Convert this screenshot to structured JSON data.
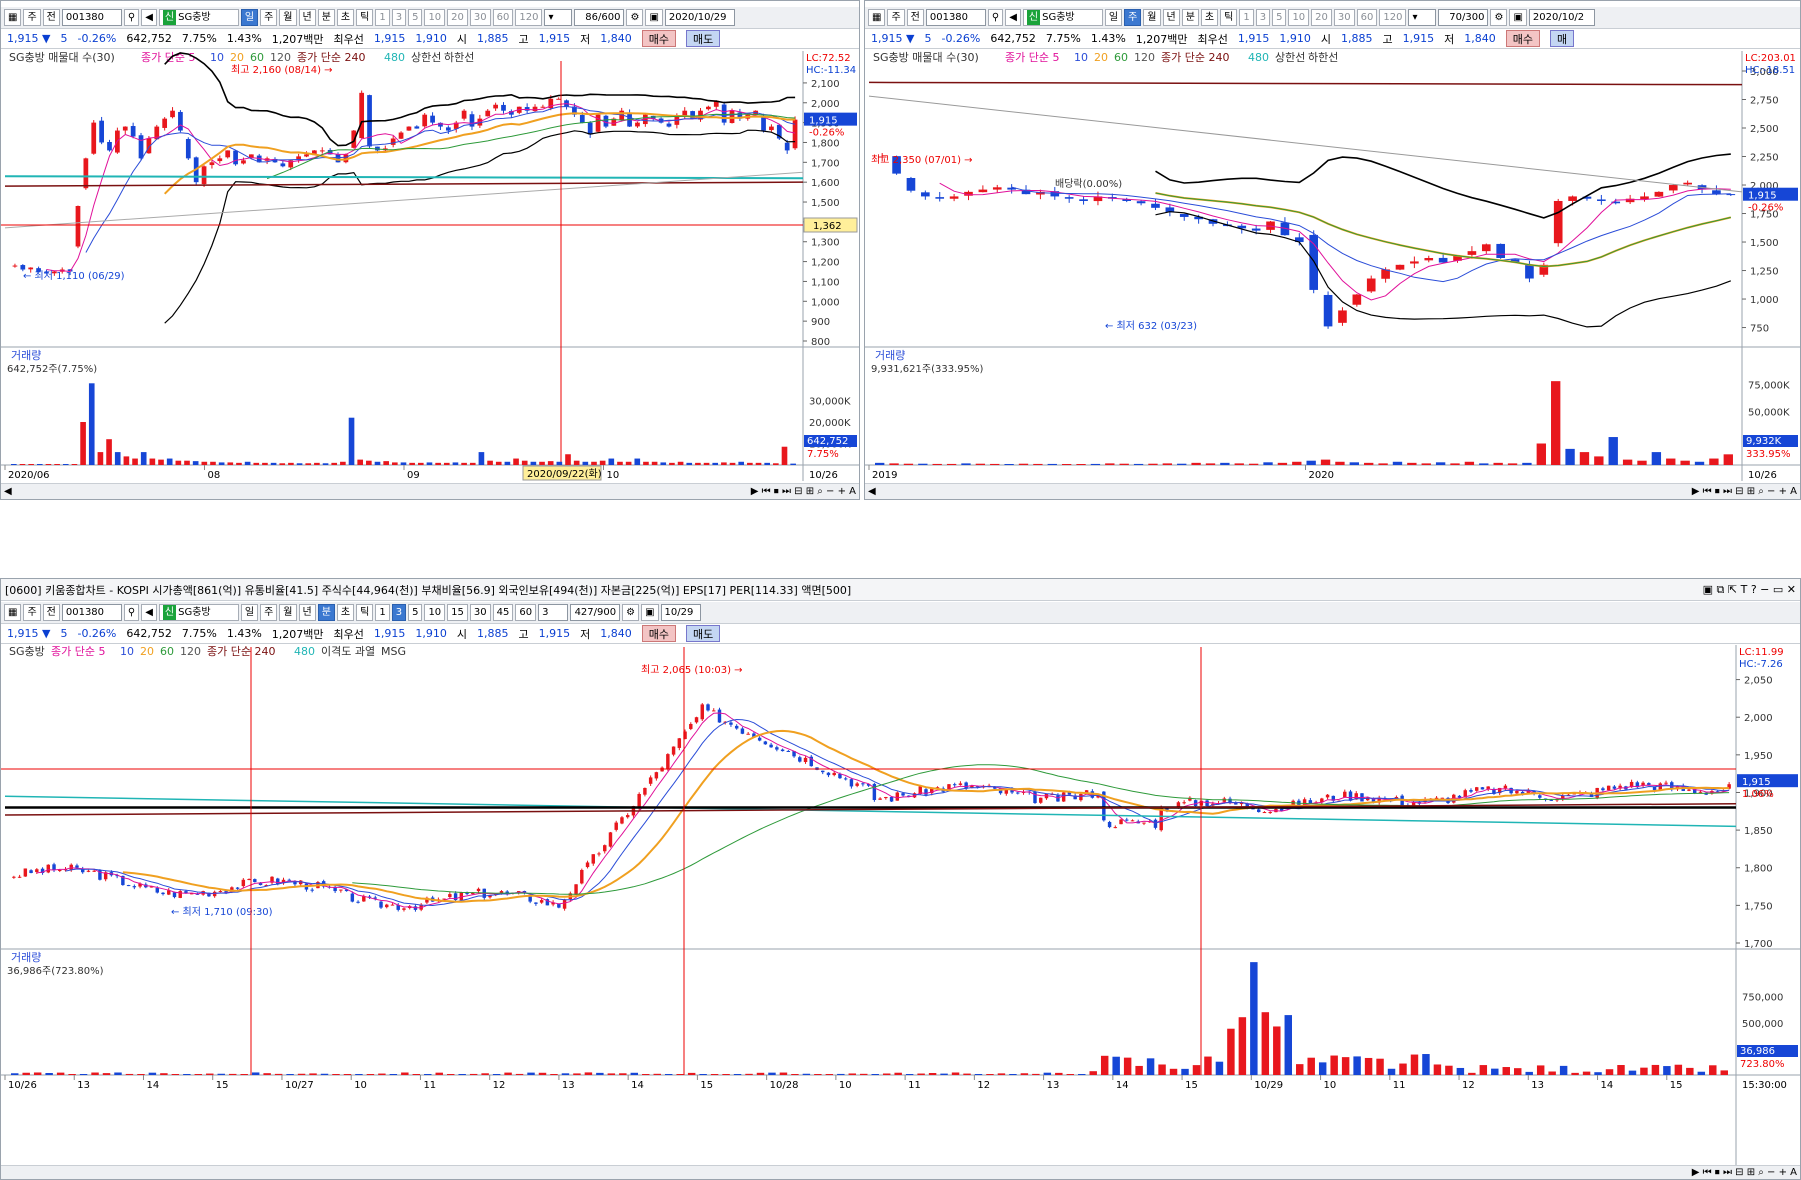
{
  "panels": {
    "topLeft": {
      "toolbar": {
        "market": "주",
        "prev": "전",
        "code": "001380",
        "name": "SG충방",
        "periods": [
          "일",
          "주",
          "월",
          "년",
          "분",
          "초",
          "틱"
        ],
        "selected": "일",
        "nums": [
          "1",
          "3",
          "5",
          "10",
          "20",
          "30",
          "60",
          "120"
        ],
        "count": "86/600",
        "date": "2020/10/29"
      },
      "quote": {
        "price": "1,915",
        "change": "5",
        "rate": "-0.26%",
        "volume": "642,752",
        "turnover": "7.75%",
        "ratio": "1.43%",
        "amount": "1,207백만",
        "pricing": "최우선",
        "ask": "1,915",
        "bid": "1,910",
        "open_label": "시",
        "open": "1,885",
        "high_label": "고",
        "high": "1,915",
        "low_label": "저",
        "low": "1,840",
        "buy": "매수",
        "sell": "매도"
      },
      "legend": {
        "l1": "SG충방 매물대 수(30)",
        "l2": "종가 단순 5",
        "l3": "10",
        "l4": "20",
        "l5": "60",
        "l6": "120",
        "l7": "상한선",
        "l8": "하한선",
        "l9": "종가 단순 240",
        "l10": "480"
      },
      "lc": "LC:72.52",
      "hc": "HC:-11.34",
      "hi_label": "최고 2,160 (08/14)",
      "lo_label": "최저 1,110 (06/29)",
      "cur_price": "1,915",
      "cur_rate": "-0.26%",
      "cursor_price": "1,362",
      "vol_title": "거래량",
      "vol_value": "642,752주(7.75%)",
      "vol_cur": "642,752",
      "vol_cur_pct": "7.75%",
      "xlabels": [
        "2020/06",
        "08",
        "09",
        "10"
      ],
      "x_end": "10/26",
      "cursor_date": "2020/09/22(화)"
    },
    "topRight": {
      "toolbar": {
        "market": "주",
        "prev": "전",
        "code": "001380",
        "name": "SG충방",
        "periods": [
          "일",
          "주",
          "월",
          "년",
          "분",
          "초",
          "틱"
        ],
        "selected": "주",
        "nums": [
          "1",
          "3",
          "5",
          "10",
          "20",
          "30",
          "60",
          "120"
        ],
        "count": "70/300",
        "date": "2020/10/2"
      },
      "quote": {
        "price": "1,915",
        "change": "5",
        "rate": "-0.26%",
        "volume": "642,752",
        "turnover": "7.75%",
        "ratio": "1.43%",
        "amount": "1,207백만",
        "pricing": "최우선",
        "ask": "1,915",
        "bid": "1,910",
        "open_label": "시",
        "open": "1,885",
        "high_label": "고",
        "high": "1,915",
        "low_label": "저",
        "low": "1,840",
        "buy": "매수",
        "sell": "매"
      },
      "legend": {
        "l1": "SG충방 매물대 수(30)",
        "l2": "종가 단순 5",
        "l3": "10",
        "l4": "20",
        "l5": "60",
        "l6": "120",
        "l9": "종가 단순 240",
        "l10": "480",
        "l7": "상한선",
        "l8": "하한선"
      },
      "lc": "LC:203.01",
      "hc": "HC:-18.51",
      "hi_label": "최고 2,350 (07/01)",
      "lo_label": "최저 632 (03/23)",
      "ex_label": "배당락(0.00%)",
      "cur_price": "1,915",
      "cur_rate": "-0.26%",
      "vol_title": "거래량",
      "vol_value": "9,931,621주(333.95%)",
      "vol_cur": "9,932K",
      "vol_cur_pct": "333.95%",
      "xlabels": [
        "2019",
        "2020"
      ],
      "x_end": "10/26"
    },
    "bottom": {
      "title": "[0600] 키움종합차트 - KOSPI 시가총액[861(억)] 유통비율[41.5] 주식수[44,964(천)] 부채비율[56.9] 외국인보유[494(천)] 자본금[225(억)] EPS[17] PER[114.33] 액면[500]",
      "toolbar": {
        "market": "주",
        "prev": "전",
        "code": "001380",
        "name": "SG충방",
        "periods": [
          "일",
          "주",
          "월",
          "년",
          "분",
          "초",
          "틱"
        ],
        "selected": "분",
        "nums": [
          "1",
          "3",
          "5",
          "10",
          "15",
          "30",
          "45",
          "60"
        ],
        "nsel": "3",
        "mult": "3",
        "count": "427/900",
        "date": "10/29"
      },
      "quote": {
        "price": "1,915",
        "change": "5",
        "rate": "-0.26%",
        "volume": "642,752",
        "turnover": "7.75%",
        "ratio": "1.43%",
        "amount": "1,207백만",
        "pricing": "최우선",
        "ask": "1,915",
        "bid": "1,910",
        "open_label": "시",
        "open": "1,885",
        "high_label": "고",
        "high": "1,915",
        "low_label": "저",
        "low": "1,840",
        "buy": "매수",
        "sell": "매도"
      },
      "legend": {
        "l1": "SG충방",
        "l2": "종가 단순 5",
        "l3": "10",
        "l4": "20",
        "l5": "60",
        "l6": "120",
        "l9": "종가 단순 240",
        "l10": "480",
        "l11": "이격도 과열",
        "l12": "MSG"
      },
      "lc": "LC:11.99",
      "hc": "HC:-7.26",
      "hi_label": "최고 2,065 (10:03)",
      "lo_label": "최저 1,710 (09:30)",
      "cur_price": "1,915",
      "cur_rate": "1.06%",
      "vol_title": "거래량",
      "vol_value": "36,986주(723.80%)",
      "vol_cur": "36,986",
      "vol_cur_pct": "723.80%",
      "xlabels": [
        "10/26",
        "13",
        "14",
        "15",
        "10/27",
        "10",
        "11",
        "12",
        "13",
        "14",
        "15",
        "10/28",
        "10",
        "11",
        "12",
        "13",
        "14",
        "15",
        "10/29",
        "10",
        "11",
        "12",
        "13",
        "14",
        "15"
      ],
      "x_end": "15:30:00"
    }
  },
  "colors": {
    "up": "#e8171d",
    "down": "#1646d6",
    "ma5": "#e0109a",
    "ma10": "#2b4dd8",
    "ma20": "#f0a020",
    "ma60": "#2e9a3a",
    "ma120": "#6fa3c8",
    "ma240": "#7a1010",
    "ma480": "#20b5b5",
    "band": "#000000"
  },
  "chart_data": [
    {
      "type": "candlestick",
      "title": "SG충방 일봉",
      "ylim": [
        800,
        2160
      ],
      "yticks": [
        800,
        900,
        1000,
        1100,
        1200,
        1300,
        1400,
        1500,
        1600,
        1700,
        1800,
        1900,
        2000,
        2100
      ],
      "close": [
        1180,
        1160,
        1170,
        1150,
        1140,
        1150,
        1160,
        1150,
        1480,
        1720,
        1900,
        1800,
        1760,
        1860,
        1880,
        1830,
        1720,
        1820,
        1880,
        1920,
        1960,
        1860,
        1720,
        1600,
        1680,
        1700,
        1720,
        1760,
        1690,
        1710,
        1740,
        1700,
        1720,
        1700,
        1680,
        1710,
        1730,
        1740,
        1760,
        1760,
        1740,
        1700,
        1740,
        1860,
        2050,
        1780,
        1760,
        1770,
        1820,
        1850,
        1880,
        1870,
        1940,
        1900,
        1880,
        1860,
        1900,
        1960,
        1880,
        1920,
        1960,
        1990,
        1960,
        1940,
        1980,
        1960,
        1980,
        1980,
        2020,
        2020,
        1980,
        1940,
        1900,
        1840,
        1940,
        1880,
        1920,
        1960,
        1880,
        1900,
        1940,
        1920,
        1900,
        1880,
        1930,
        1960,
        1920,
        1960,
        1980,
        2010,
        1900,
        1960,
        1920,
        1940,
        1960,
        1860,
        1880,
        1820,
        1760,
        1915
      ],
      "volume_k": [
        300,
        250,
        200,
        200,
        150,
        150,
        200,
        200,
        20000,
        38000,
        6000,
        12000,
        6000,
        4000,
        3000,
        6000,
        3000,
        2500,
        3000,
        2000,
        2000,
        1800,
        1500,
        1500,
        1200,
        1200,
        1000,
        1500,
        1000,
        1000,
        1000,
        800,
        1000,
        800,
        800,
        1000,
        800,
        1000,
        1500,
        22000,
        2500,
        2000,
        1500,
        1800,
        1200,
        1200,
        1000,
        1000,
        1200,
        1000,
        1000,
        1200,
        1000,
        1000,
        6000,
        2000,
        1500,
        1500,
        3000,
        2000,
        1500,
        1500,
        1800,
        1500,
        5000,
        2000,
        1500,
        1500,
        2000,
        3000,
        1500,
        1500,
        3000,
        1500,
        1500,
        1200,
        1000,
        1500,
        1000,
        1000,
        1000,
        1000,
        1200,
        1000,
        1500,
        1000,
        1000,
        1000,
        800,
        8500,
        643
      ]
    },
    {
      "type": "candlestick",
      "title": "SG충방 주봉",
      "ylim": [
        632,
        3000
      ],
      "yticks": [
        750,
        1000,
        1250,
        1500,
        1750,
        2000,
        2250,
        2500,
        2750,
        3000
      ],
      "close": [
        2250,
        2100,
        1950,
        1900,
        1880,
        1900,
        1940,
        1960,
        1980,
        1960,
        1920,
        1940,
        1900,
        1880,
        1860,
        1900,
        1880,
        1860,
        1840,
        1800,
        1760,
        1720,
        1700,
        1660,
        1640,
        1620,
        1600,
        1680,
        1560,
        1500,
        1080,
        760,
        900,
        1040,
        1180,
        1260,
        1300,
        1330,
        1360,
        1320,
        1380,
        1420,
        1480,
        1360,
        1320,
        1180,
        1300,
        1860,
        1900,
        1880,
        1860,
        1840,
        1880,
        1900,
        1940,
        2000,
        2020,
        1960,
        1920,
        1915
      ],
      "volume_k": [
        2000,
        1500,
        1200,
        1200,
        1000,
        1000,
        1500,
        1200,
        1000,
        800,
        1200,
        1000,
        1000,
        800,
        800,
        1000,
        1500,
        1200,
        1000,
        1200,
        1500,
        1200,
        2000,
        1500,
        2000,
        1500,
        1200,
        2500,
        2000,
        3000,
        4000,
        5000,
        3000,
        2500,
        2000,
        1500,
        3000,
        2000,
        1500,
        2500,
        1500,
        3000,
        1500,
        2000,
        1500,
        2000,
        20000,
        78000,
        15000,
        12000,
        8000,
        26000,
        5000,
        4000,
        12000,
        6000,
        4000,
        3000,
        6000,
        9932
      ]
    },
    {
      "type": "candlestick",
      "title": "SG충방 3분봉",
      "ylim": [
        1700,
        2080
      ],
      "yticks": [
        1700,
        1750,
        1800,
        1850,
        1900,
        1950,
        2000,
        2050
      ],
      "volume_k": [
        0,
        0,
        0,
        0,
        0,
        0,
        0,
        0,
        0,
        0,
        0,
        0,
        0,
        0,
        0,
        0,
        0,
        0,
        0,
        0,
        0,
        0,
        0,
        0,
        0,
        0,
        0,
        0,
        0,
        0,
        0,
        0,
        0,
        0,
        0,
        0,
        0,
        0,
        0,
        0,
        0,
        0,
        0,
        0,
        0,
        0,
        0,
        0,
        0,
        0,
        0,
        0,
        0,
        0,
        0,
        0,
        0,
        0,
        0,
        0,
        0,
        0,
        0,
        0,
        0,
        0,
        0,
        0,
        0,
        0,
        0,
        0,
        0,
        0,
        0,
        0,
        0,
        0,
        0,
        0,
        0,
        0,
        0,
        0,
        0,
        0,
        0,
        0,
        0,
        0,
        0,
        0,
        0,
        0,
        0,
        0,
        0,
        0,
        0,
        0,
        0,
        0,
        0,
        0,
        0,
        0,
        0,
        0,
        0,
        0,
        0,
        0,
        0,
        0,
        0,
        0,
        0,
        0,
        0,
        0,
        0,
        0,
        0,
        0,
        0,
        0,
        0,
        0,
        0,
        0,
        0,
        0,
        0,
        0,
        0,
        0,
        0,
        0,
        0,
        0,
        0,
        0,
        0,
        0,
        0,
        0,
        0,
        0,
        0,
        37
      ]
    }
  ]
}
